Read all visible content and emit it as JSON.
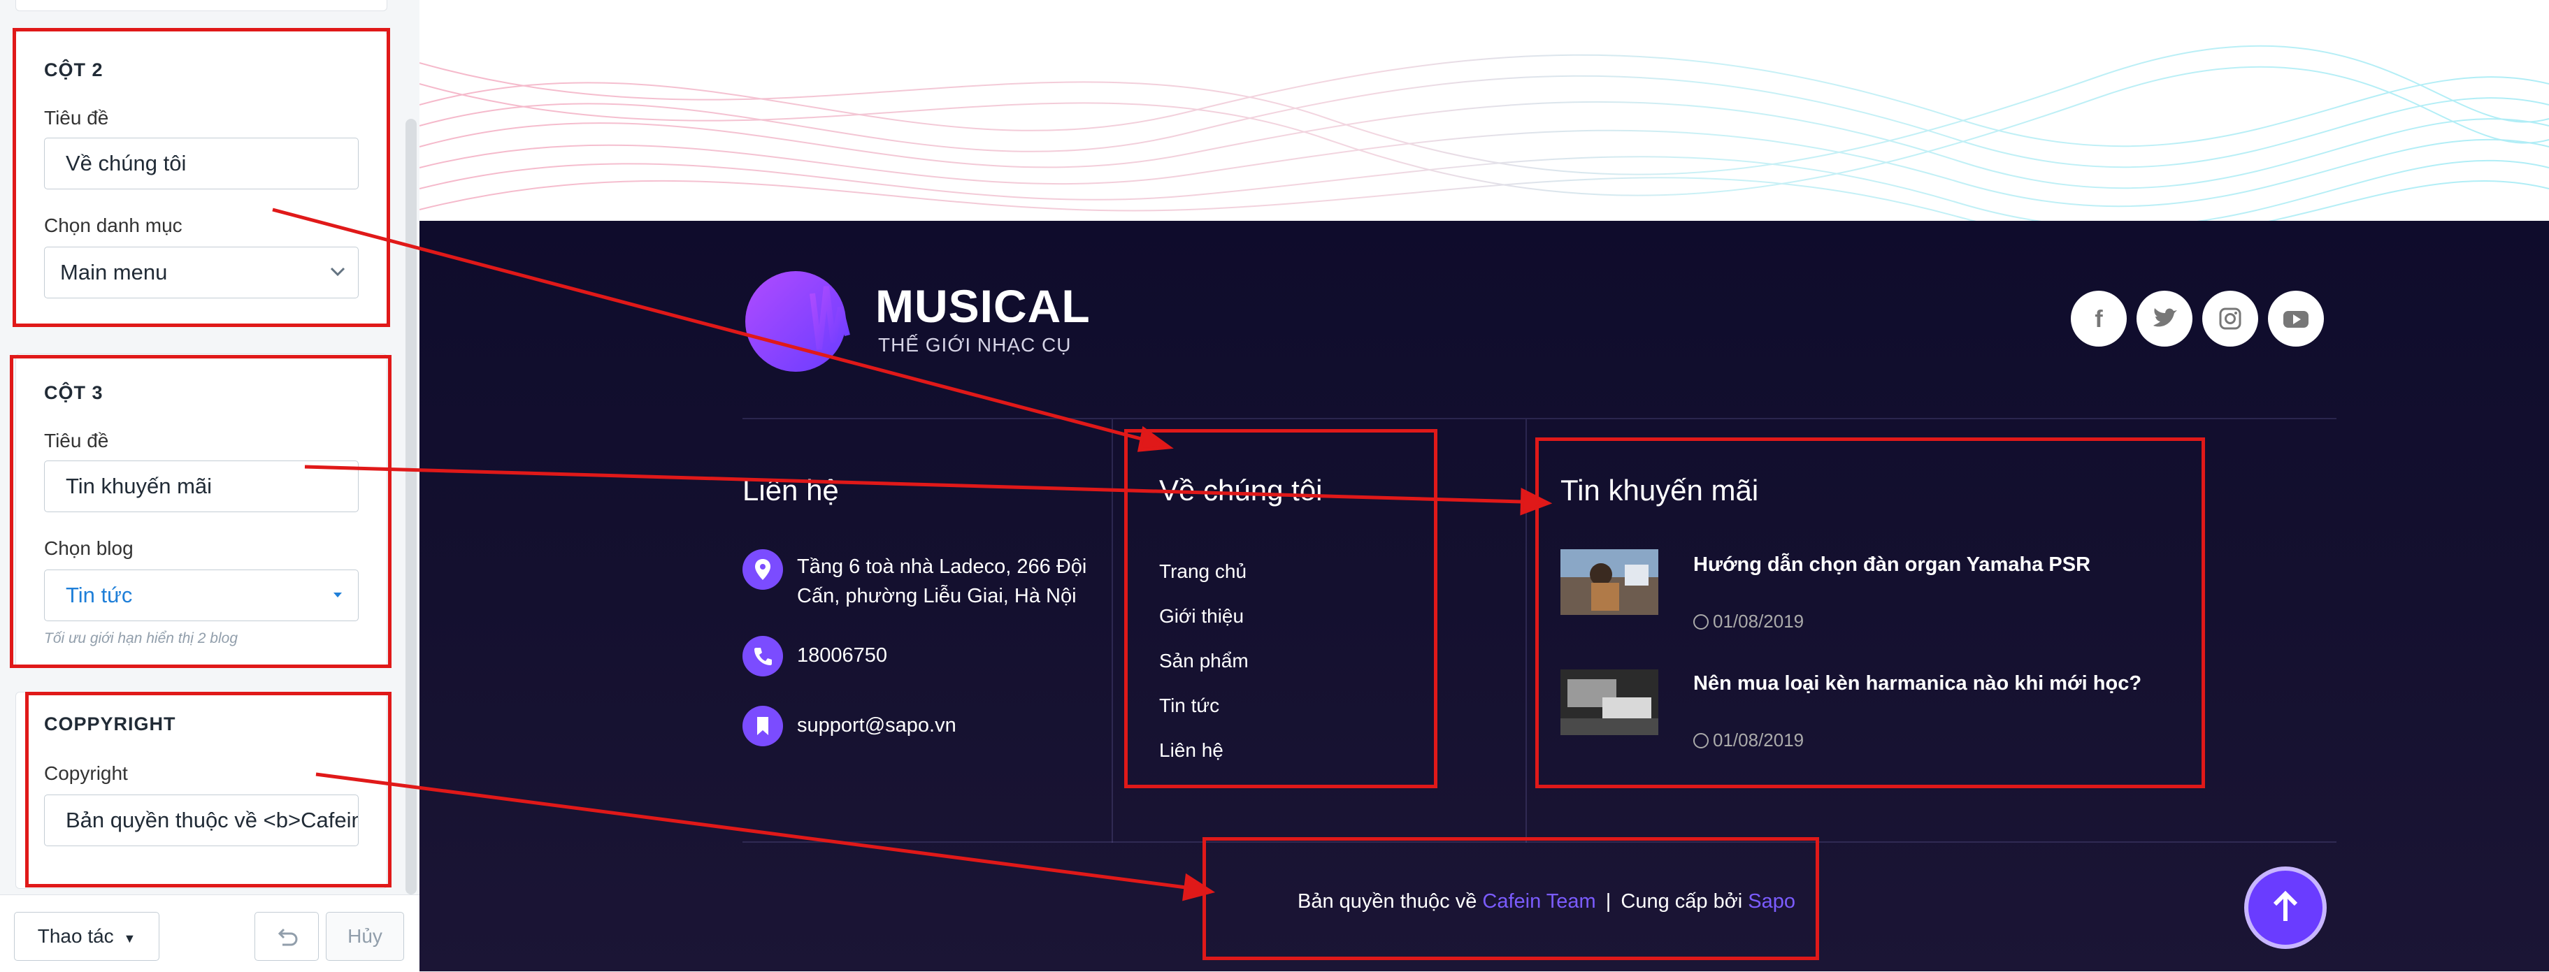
{
  "sidebar": {
    "col2": {
      "heading": "CỘT 2",
      "title_label": "Tiêu đề",
      "title_value": "Về chúng tôi",
      "category_label": "Chọn danh mục",
      "category_value": "Main menu"
    },
    "col3": {
      "heading": "CỘT 3",
      "title_label": "Tiêu đề",
      "title_value": "Tin khuyến mãi",
      "blog_label": "Chọn blog",
      "blog_value": "Tin tức",
      "hint": "Tối ưu giới hạn hiển thị 2 blog"
    },
    "copyright": {
      "heading": "COPPYRIGHT",
      "label": "Copyright",
      "value": "Bản quyền thuộc về <b>Cafein"
    },
    "actions": {
      "action_label": "Thao tác",
      "cancel_label": "Hủy"
    }
  },
  "footer": {
    "brand": {
      "name": "MUSICAL",
      "tagline": "THẾ GIỚI NHẠC CỤ"
    },
    "social_icons": [
      "facebook-icon",
      "twitter-icon",
      "instagram-icon",
      "youtube-icon"
    ],
    "contact": {
      "title": "Liên hệ",
      "address": "Tầng 6 toà nhà Ladeco, 266 Đội Cấn, phường Liễu Giai, Hà Nội",
      "phone": "18006750",
      "email": "support@sapo.vn"
    },
    "about": {
      "title": "Về chúng tôi",
      "links": [
        "Trang chủ",
        "Giới thiệu",
        "Sản phẩm",
        "Tin tức",
        "Liên hệ"
      ]
    },
    "news": {
      "title": "Tin khuyến mãi",
      "items": [
        {
          "title": "Hướng dẫn chọn đàn organ Yamaha PSR",
          "date": "01/08/2019"
        },
        {
          "title": "Nên mua loại kèn harmanica nào khi mới học?",
          "date": "01/08/2019"
        }
      ]
    },
    "copyright": {
      "prefix": "Bản quyền thuộc về",
      "owner": "Cafein Team",
      "separator": "|",
      "provider_prefix": "Cung cấp bởi",
      "provider": "Sapo"
    }
  },
  "colors": {
    "accent": "#7b4cff",
    "annotation": "#e01919",
    "footer_bg": "#0f0c2c"
  }
}
